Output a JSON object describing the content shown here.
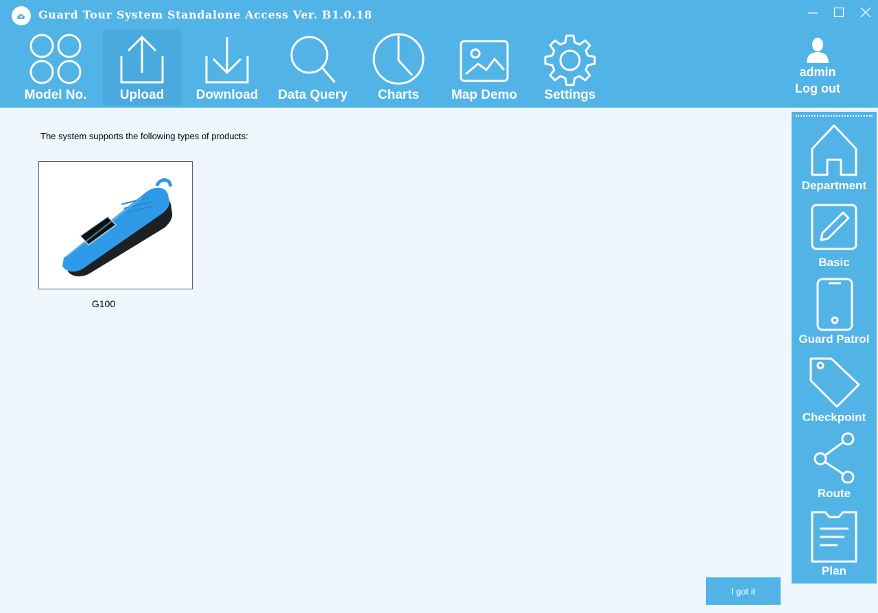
{
  "window": {
    "title": "Guard Tour System Standalone Access Ver. B1.0.18",
    "icons": [
      "cloud-logo-icon",
      "minimize-icon",
      "maximize-icon",
      "close-icon"
    ]
  },
  "toolbar": {
    "items": [
      {
        "label": "Model No.",
        "icon": "grid-circles-icon",
        "active": false
      },
      {
        "label": "Upload",
        "icon": "upload-icon",
        "active": true
      },
      {
        "label": "Download",
        "icon": "download-icon",
        "active": false
      },
      {
        "label": "Data Query",
        "icon": "search-icon",
        "active": false
      },
      {
        "label": "Charts",
        "icon": "clock-chart-icon",
        "active": false
      },
      {
        "label": "Map Demo",
        "icon": "image-icon",
        "active": false
      },
      {
        "label": "Settings",
        "icon": "gear-icon",
        "active": false
      }
    ]
  },
  "user": {
    "name": "admin",
    "logout_label": "Log out",
    "icon": "user-icon"
  },
  "main": {
    "intro_text": "The system supports the following types of products:",
    "products": [
      {
        "name": "G100"
      }
    ],
    "confirm_button": "I got it"
  },
  "sidebar": {
    "items": [
      {
        "label": "Department",
        "icon": "house-icon"
      },
      {
        "label": "Basic",
        "icon": "edit-icon"
      },
      {
        "label": "Guard Patrol",
        "icon": "phone-icon"
      },
      {
        "label": "Checkpoint",
        "icon": "tag-icon"
      },
      {
        "label": "Route",
        "icon": "share-icon"
      },
      {
        "label": "Plan",
        "icon": "clipboard-icon"
      }
    ]
  },
  "colors": {
    "accent": "#52b3e6",
    "active_tab": "#4aa9de",
    "background": "#eef6fe",
    "product_device": "#2f9be8"
  }
}
